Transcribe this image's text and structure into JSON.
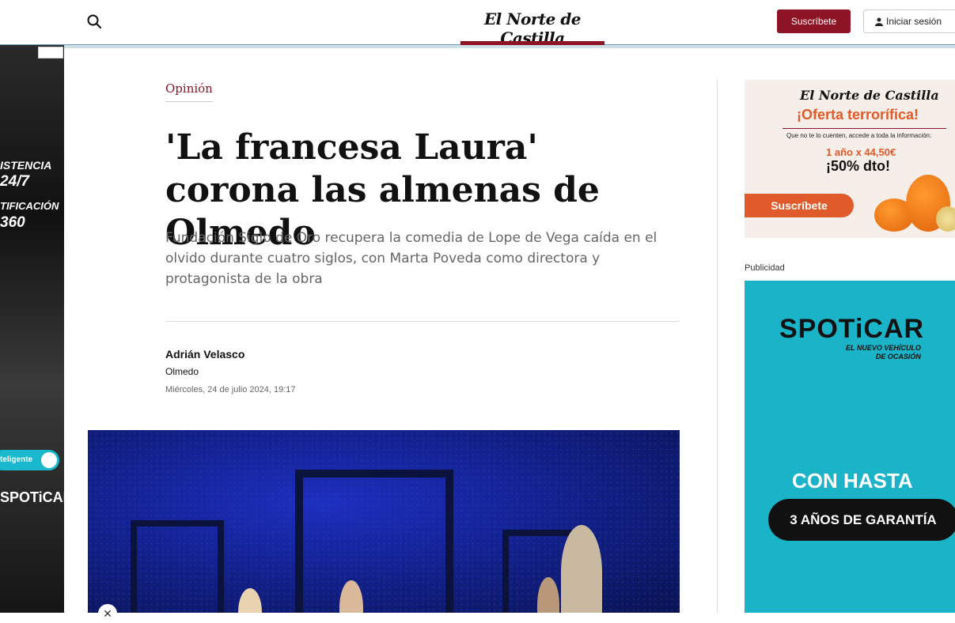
{
  "header": {
    "logo": "El Norte de Castilla",
    "subscribe_label": "Suscríbete",
    "login_label": "Iniciar sesión"
  },
  "left_ad": {
    "line1": "ISTENCIA",
    "line2": "24/7",
    "line3": "TIFICACIÓN",
    "line4": "360",
    "pill": "teligente",
    "brand": "SPOTiCAR"
  },
  "article": {
    "section": "Opinión",
    "title": "'La francesa Laura' corona las almenas de Olmedo",
    "subtitle": "Fundación Siglo de Oro recupera la comedia de Lope de Vega caída en el olvido durante cuatro siglos, con Marta Poveda como directora y protagonista de la obra",
    "author": "Adrián Velasco",
    "location": "Olmedo",
    "date": "Miércoles, 24 de julio 2024, 19:17"
  },
  "promo": {
    "logo": "El Norte de Castilla",
    "offer": "¡Oferta terrorífica!",
    "desc": "Que no te lo cuenten, accede a toda la información:",
    "price": "1 año x 44,50€",
    "discount": "¡50% dto!",
    "button": "Suscríbete"
  },
  "sidebar": {
    "ad_label": "Publicidad"
  },
  "right_ad": {
    "brand": "SPOTiCAR",
    "tagline_1": "EL NUEVO VEHÍCULO",
    "tagline_2": "DE OCASIÓN",
    "headline": "CON HASTA",
    "pill": "3 AÑOS DE GARANTÍA"
  },
  "colors": {
    "brand": "#8c1424",
    "promo_orange": "#e05a2a",
    "ad_teal": "#1bb3c8"
  }
}
